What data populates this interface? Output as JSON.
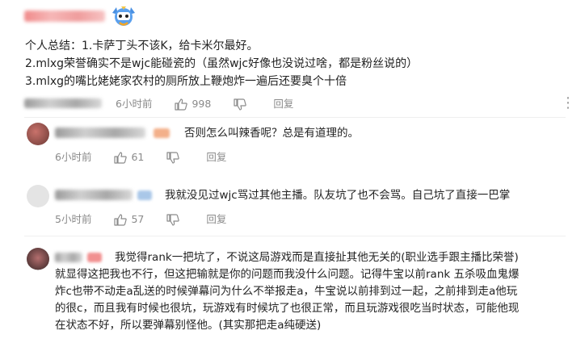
{
  "top_comment": {
    "lines": [
      "个人总结：1.卡萨丁头不该K，给卡米尔最好。",
      "2.mlxg荣誉确实不是wjc能碰瓷的（虽然wjc好像也没说过啥，都是粉丝说的）",
      "3.mlxg的嘴比姥姥家农村的厕所放上鞭炮炸一遍后还要臭个十倍"
    ],
    "time": "6小时前",
    "likes": "998",
    "reply_label": "回复"
  },
  "replies": [
    {
      "text": "否则怎么叫辣香呢？总是有道理的。",
      "time": "6小时前",
      "likes": "61",
      "reply_label": "回复"
    },
    {
      "text": "我就没见过wjc骂过其他主播。队友坑了也不会骂。自己坑了直接一巴掌",
      "time": "5小时前",
      "likes": "57",
      "reply_label": "回复"
    },
    {
      "lines": [
        "我觉得rank一把坑了，不说这局游戏而是直接扯其他无关的(职业选手跟主播比荣誉)",
        "就显得这把我也不行，但这把输就是你的问题而我没什么问题。记得牛宝以前rank 五杀吸血鬼爆",
        "炸c也带不动走a乱送的时候弹幕问为什么不举报走a，牛宝说以前排到过一起，之前排到走a他玩",
        "的很c，而且我有时候也很坑，玩游戏有时候坑了也很正常，而且玩游戏很吃当时状态，可能他现",
        "在状态不好，所以要弹幕别怪他。(其实那把走a纯硬送)"
      ]
    }
  ],
  "icons": {
    "like": "thumbs-up-icon",
    "dislike": "thumbs-down-icon",
    "more": "more-dots-icon",
    "badge": "mascot-badge-icon"
  },
  "colors": {
    "meta": "#8a8a8a",
    "pink_name": "#f08a8a"
  }
}
